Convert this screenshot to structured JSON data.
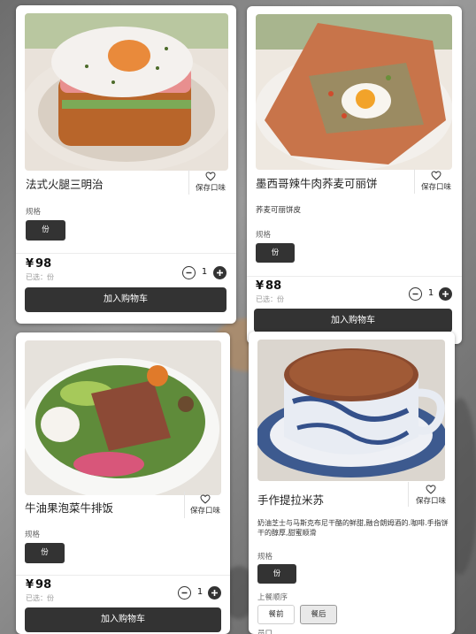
{
  "colors": {
    "button_dark": "#333333",
    "card": "#ffffff",
    "backdrop": "#7b7b7b"
  },
  "cards": [
    {
      "id": "croque",
      "title": "法式火腿三明治",
      "favorite_label": "保存口味",
      "description": "",
      "spec_label": "规格",
      "spec_option": "份",
      "price_symbol": "¥",
      "price": "98",
      "chosen": "已选：份",
      "quantity": "1",
      "cart_label": "加入购物车",
      "icons": [
        "heart-icon",
        "minus-icon",
        "plus-icon"
      ]
    },
    {
      "id": "crepe",
      "title": "墨西哥辣牛肉荞麦可丽饼",
      "favorite_label": "保存口味",
      "description": "荞麦可丽饼皮",
      "spec_label": "规格",
      "spec_option": "份",
      "price_symbol": "¥",
      "price": "88",
      "chosen": "已选：份",
      "quantity": "1",
      "cart_label": "加入购物车",
      "icons": [
        "heart-icon",
        "minus-icon",
        "plus-icon"
      ]
    },
    {
      "id": "bowl",
      "title": "牛油果泡菜牛排饭",
      "favorite_label": "保存口味",
      "description": "",
      "spec_label": "规格",
      "spec_option": "份",
      "price_symbol": "¥",
      "price": "98",
      "chosen": "已选：份",
      "quantity": "1",
      "cart_label": "加入购物车",
      "icons": [
        "heart-icon",
        "minus-icon",
        "plus-icon"
      ]
    },
    {
      "id": "tiramisu",
      "title": "手作提拉米苏",
      "favorite_label": "保存口味",
      "description": "奶油芝士与马斯克布尼干酪的鲜甜,融合朗姆酒的.咖啡.手指饼干的醇厚,甜蜜顺滑",
      "spec_label": "规格",
      "spec_option": "份",
      "serving_label": "上餐顺序",
      "serving_options": [
        "餐前",
        "餐后"
      ],
      "serving_selected": "餐后",
      "extra_label": "员口",
      "icons": [
        "heart-icon"
      ]
    }
  ]
}
